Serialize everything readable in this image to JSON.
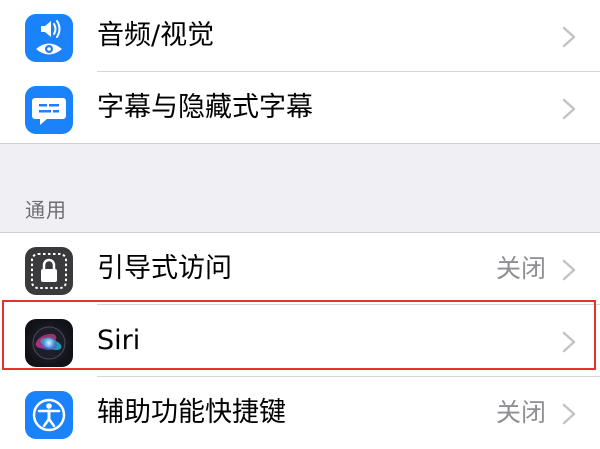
{
  "top_group": {
    "items": [
      {
        "label": "音频/视觉",
        "icon": "speaker-eye-icon",
        "icon_color": "#1a82fb"
      },
      {
        "label": "字幕与隐藏式字幕",
        "icon": "captions-bubble-icon",
        "icon_color": "#1a82fb"
      }
    ]
  },
  "general_section": {
    "header": "通用",
    "items": [
      {
        "label": "引导式访问",
        "value": "关闭",
        "icon": "lock-icon",
        "icon_color": "#3a3a3c"
      },
      {
        "label": "Siri",
        "value": "",
        "icon": "siri-icon",
        "icon_color": "#1c1c1e",
        "highlighted": true
      },
      {
        "label": "辅助功能快捷键",
        "value": "关闭",
        "icon": "accessibility-icon",
        "icon_color": "#1a82fb"
      }
    ]
  },
  "colors": {
    "background": "#efeff4",
    "highlight_border": "#e8302c",
    "secondary_text": "#8e8e93"
  }
}
